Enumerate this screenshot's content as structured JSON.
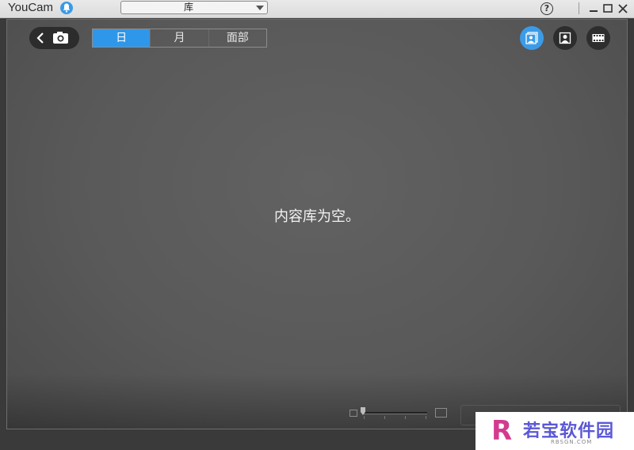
{
  "titlebar": {
    "app_name": "YouCam",
    "dropdown_selected": "库",
    "help_label": "?"
  },
  "toolbar": {
    "tabs": [
      {
        "label": "日",
        "active": true
      },
      {
        "label": "月",
        "active": false
      },
      {
        "label": "面部",
        "active": false
      }
    ]
  },
  "main": {
    "empty_message": "内容库为空。"
  },
  "watermark": {
    "logo_letter": "R",
    "brand_text": "若宝软件园",
    "domain_text": "RBSGN.COM"
  },
  "colors": {
    "accent": "#2f97e9",
    "panel": "#5c5c5c",
    "titlebar": "#e3e3e3"
  }
}
